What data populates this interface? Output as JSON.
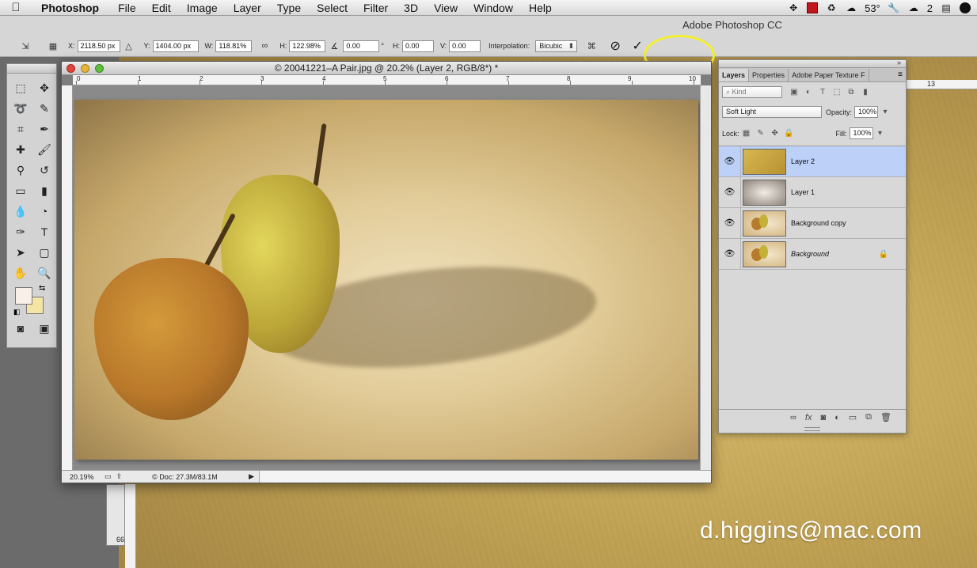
{
  "menubar": {
    "app_name": "Photoshop",
    "menus": [
      "File",
      "Edit",
      "Image",
      "Layer",
      "Type",
      "Select",
      "Filter",
      "3D",
      "View",
      "Window",
      "Help"
    ],
    "status": {
      "temperature": "53°",
      "notification_count": "2"
    }
  },
  "app_title": "Adobe Photoshop CC",
  "transform_options": {
    "x_label": "X:",
    "x_value": "2118.50 px",
    "y_label": "Y:",
    "y_value": "1404.00 px",
    "w_label": "W:",
    "w_value": "118.81%",
    "h_label": "H:",
    "h_value": "122.98%",
    "angle_value": "0.00",
    "hskew_label": "H:",
    "hskew_value": "0.00",
    "vskew_label": "V:",
    "vskew_value": "0.00",
    "degree_symbol": "°",
    "interpolation_label": "Interpolation:",
    "interpolation_value": "Bicubic"
  },
  "document": {
    "title": "© 20041221–A Pair.jpg @ 20.2% (Layer 2, RGB/8*) *",
    "ruler_numbers": [
      "0",
      "1",
      "2",
      "3",
      "4",
      "5",
      "6",
      "7",
      "8",
      "9",
      "10"
    ],
    "zoom": "20.19%",
    "doc_info": "© Doc: 27.3M/83.1M"
  },
  "background_doc": {
    "ruler_label": "66",
    "ruler_number_13": "13"
  },
  "layers_panel": {
    "tabs": [
      "Layers",
      "Properties",
      "Adobe Paper Texture F"
    ],
    "filter_placeholder": "Kind",
    "blend_mode": "Soft Light",
    "opacity_label": "Opacity:",
    "opacity_value": "100%",
    "lock_label": "Lock:",
    "fill_label": "Fill:",
    "fill_value": "100%",
    "layers": [
      {
        "name": "Layer 2",
        "selected": true
      },
      {
        "name": "Layer 1",
        "selected": false
      },
      {
        "name": "Background copy",
        "selected": false
      },
      {
        "name": "Background",
        "selected": false,
        "locked": true
      }
    ]
  },
  "watermark": "d.higgins@mac.com",
  "colors": {
    "foreground": "#f8f0e8",
    "background": "#f5e5a5",
    "highlight": "#f2ef35",
    "selected_layer": "#bcd0f8"
  }
}
